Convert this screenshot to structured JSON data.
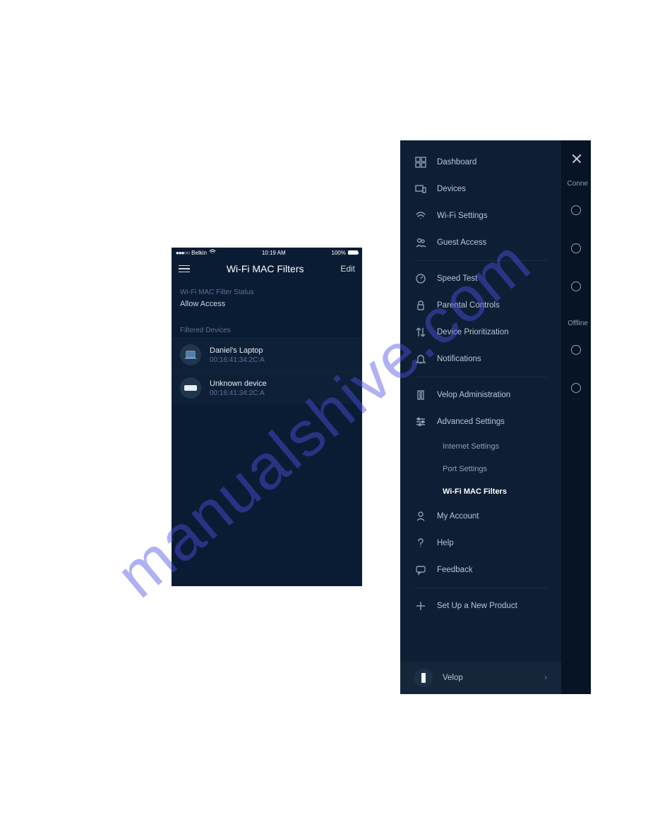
{
  "left_phone": {
    "status": {
      "carrier": "Belkin",
      "time": "10:19 AM",
      "battery_pct": "100%"
    },
    "nav": {
      "title": "Wi-Fi MAC Filters",
      "edit": "Edit"
    },
    "status_label": "Wi-Fi MAC Filter Status",
    "status_value": "Allow Access",
    "filtered_label": "Filtered Devices",
    "devices": [
      {
        "name": "Daniel's Laptop",
        "mac": "00:16:41:34:2C:A",
        "icon": "laptop"
      },
      {
        "name": "Unknown device",
        "mac": "00:16:41:34:2C:A",
        "icon": "router"
      }
    ]
  },
  "menu": {
    "items": [
      {
        "icon": "dashboard",
        "label": "Dashboard"
      },
      {
        "icon": "devices",
        "label": "Devices"
      },
      {
        "icon": "wifi",
        "label": "Wi-Fi Settings"
      },
      {
        "icon": "guest",
        "label": "Guest Access"
      }
    ],
    "items2": [
      {
        "icon": "speed",
        "label": "Speed Test"
      },
      {
        "icon": "parental",
        "label": "Parental Controls"
      },
      {
        "icon": "priority",
        "label": "Device Prioritization"
      },
      {
        "icon": "bell",
        "label": "Notifications"
      }
    ],
    "items3": [
      {
        "icon": "admin",
        "label": "Velop Administration"
      },
      {
        "icon": "sliders",
        "label": "Advanced Settings"
      }
    ],
    "subitems": [
      {
        "label": "Internet Settings"
      },
      {
        "label": "Port Settings"
      },
      {
        "label": "Wi-Fi MAC Filters",
        "active": true
      }
    ],
    "items4": [
      {
        "icon": "account",
        "label": "My Account"
      },
      {
        "icon": "help",
        "label": "Help"
      },
      {
        "icon": "feedback",
        "label": "Feedback"
      }
    ],
    "setup": {
      "label": "Set Up a New Product"
    },
    "footer": {
      "label": "Velop"
    }
  },
  "right_strip": {
    "connected_label": "Conne",
    "offline_label": "Offline"
  },
  "watermark": "manualshive.com"
}
